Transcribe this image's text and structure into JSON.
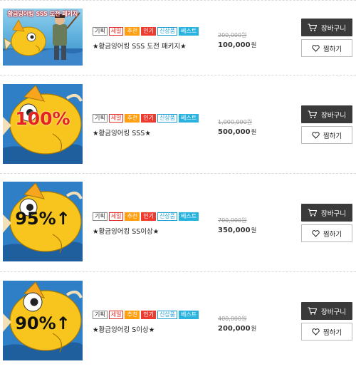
{
  "badge_labels": {
    "plan": "기획",
    "sale": "세일",
    "recommend": "추천",
    "popular": "인기",
    "new_product": "신상품",
    "best": "베스트"
  },
  "buttons": {
    "cart_label": "장바구니",
    "wish_label": "찜하기",
    "cart_icon": "cart-icon",
    "wish_icon": "heart-icon"
  },
  "products": [
    {
      "thumb_text": "황금잉어킹 SSS 도전 패키지",
      "title": "★황금잉어킹 SSS 도전 패키지★",
      "original_price": "200,000원",
      "price": "100,000",
      "currency": "원"
    },
    {
      "thumb_text": "100%",
      "title": "★황금잉어킹 SSS★",
      "original_price": "1,000,000원",
      "price": "500,000",
      "currency": "원"
    },
    {
      "thumb_text": "95%↑",
      "title": "★황금잉어킹 SS이상★",
      "original_price": "700,000원",
      "price": "350,000",
      "currency": "원"
    },
    {
      "thumb_text": "90%↑",
      "title": "★황금잉어킹 S이상★",
      "original_price": "400,000원",
      "price": "200,000",
      "currency": "원"
    }
  ],
  "colors": {
    "cart_button_bg": "#3a3a3a",
    "badge_recommend": "#ff9f0f",
    "badge_popular": "#ee3a2f",
    "badge_best": "#2bb3e0",
    "badge_sale": "#e0312b",
    "fish_gold": "#f7c51e",
    "water_blue": "#2d7bc4"
  }
}
